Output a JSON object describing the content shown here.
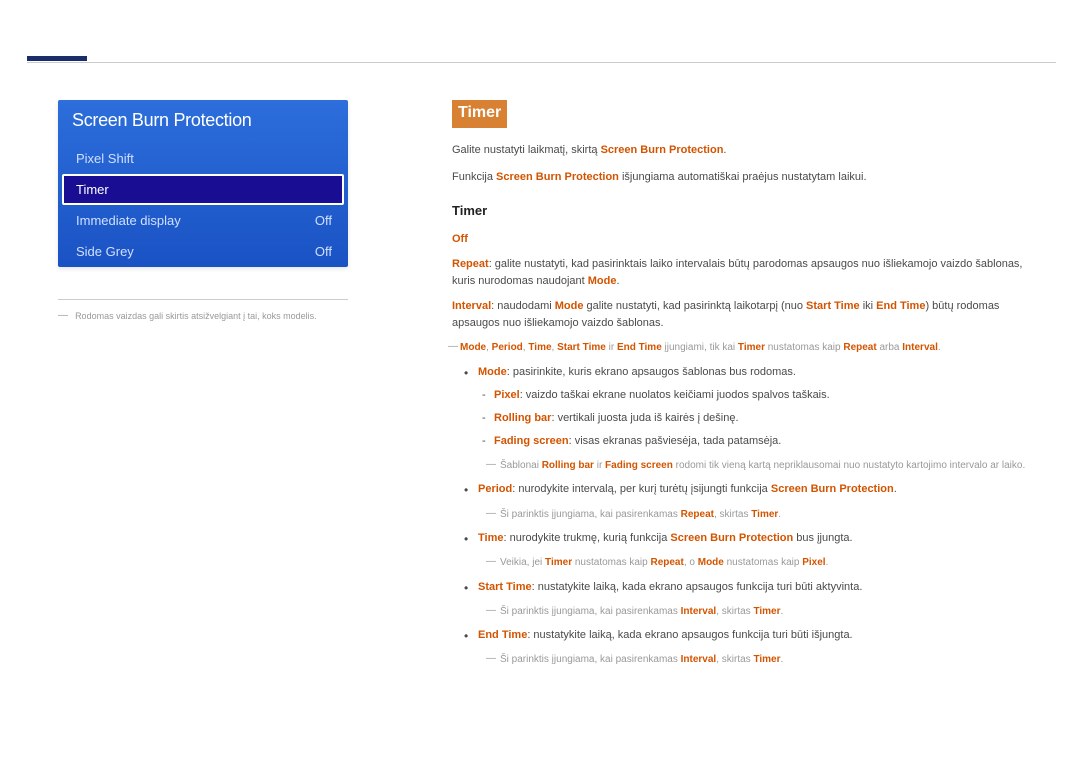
{
  "panel": {
    "title": "Screen Burn Protection",
    "items": [
      {
        "label": "Pixel Shift",
        "value": ""
      },
      {
        "label": "Timer",
        "value": "",
        "selected": true
      },
      {
        "label": "Immediate display",
        "value": "Off"
      },
      {
        "label": "Side Grey",
        "value": "Off"
      }
    ]
  },
  "left_footnote": "Rodomas vaizdas gali skirtis atsižvelgiant į tai, koks modelis.",
  "heading_block": "Timer",
  "intro1_pre": "Galite nustatyti laikmatį, skirtą ",
  "intro1_kw": "Screen Burn Protection",
  "intro1_post": ".",
  "intro2_pre": "Funkcija ",
  "intro2_kw": "Screen Burn Protection",
  "intro2_post": " išjungiama automatiškai praėjus nustatytam laikui.",
  "subheading": "Timer",
  "off_label": "Off",
  "repeat_kw": "Repeat",
  "repeat_text": ": galite nustatyti, kad pasirinktais laiko intervalais būtų parodomas apsaugos nuo išliekamojo vaizdo šablonas, kuris nurodomas naudojant ",
  "repeat_tail_kw": "Mode",
  "repeat_tail": ".",
  "interval_kw": "Interval",
  "interval_t1": ": naudodami ",
  "interval_mode": "Mode",
  "interval_t2": " galite nustatyti, kad pasirinktą laikotarpį (nuo ",
  "interval_start": "Start Time",
  "interval_t3": " iki ",
  "interval_end": "End Time",
  "interval_t4": ") būtų rodomas apsaugos nuo išliekamojo vaizdo šablonas.",
  "note1": {
    "kw_mode": "Mode",
    "kw_period": "Period",
    "kw_time": "Time",
    "kw_start": "Start Time",
    "kw_end": "End Time",
    "kw_timer": "Timer",
    "kw_repeat": "Repeat",
    "kw_interval": "Interval",
    "t1": ", ",
    "t_and": " ir ",
    "t_mid": " įjungiami, tik kai ",
    "t_set": " nustatomas kaip ",
    "t_or": " arba ",
    "t_end": "."
  },
  "mode_line_kw": "Mode",
  "mode_line_text": ": pasirinkite, kuris ekrano apsaugos šablonas bus rodomas.",
  "mode_sub": {
    "pixel_kw": "Pixel",
    "pixel_text": ": vaizdo taškai ekrane nuolatos keičiami juodos spalvos taškais.",
    "rolling_kw": "Rolling bar",
    "rolling_text": ": vertikali juosta juda iš kairės į dešinę.",
    "fading_kw": "Fading screen",
    "fading_text": ": visas ekranas pašviesėja, tada patamsėja."
  },
  "mode_note": {
    "pre": "Šablonai ",
    "kw1": "Rolling bar",
    "mid1": " ir ",
    "kw2": "Fading screen",
    "post": " rodomi tik vieną kartą nepriklausomai nuo nustatyto kartojimo intervalo ar laiko."
  },
  "period_kw": "Period",
  "period_t1": ": nurodykite intervalą, per kurį turėtų įsijungti funkcija ",
  "period_kw2": "Screen Burn Protection",
  "period_t2": ".",
  "period_note": {
    "pre": "Ši parinktis įjungiama, kai pasirenkamas ",
    "kw1": "Repeat",
    "mid": ", skirtas ",
    "kw2": "Timer",
    "post": "."
  },
  "time_kw": "Time",
  "time_t1": ": nurodykite trukmę, kurią funkcija ",
  "time_kw2": "Screen Burn Protection",
  "time_t2": " bus įjungta.",
  "time_note": {
    "pre": "Veikia, jei ",
    "kw1": "Timer",
    "mid1": " nustatomas kaip ",
    "kw2": "Repeat",
    "mid2": ", o ",
    "kw3": "Mode",
    "mid3": " nustatomas kaip ",
    "kw4": "Pixel",
    "post": "."
  },
  "start_kw": "Start Time",
  "start_text": ": nustatykite laiką, kada ekrano apsaugos funkcija turi būti aktyvinta.",
  "start_note": {
    "pre": "Ši parinktis įjungiama, kai pasirenkamas ",
    "kw1": "Interval",
    "mid": ", skirtas ",
    "kw2": "Timer",
    "post": "."
  },
  "end_kw": "End Time",
  "end_text": ": nustatykite laiką, kada ekrano apsaugos funkcija turi būti išjungta.",
  "end_note": {
    "pre": "Ši parinktis įjungiama, kai pasirenkamas ",
    "kw1": "Interval",
    "mid": ", skirtas ",
    "kw2": "Timer",
    "post": "."
  }
}
